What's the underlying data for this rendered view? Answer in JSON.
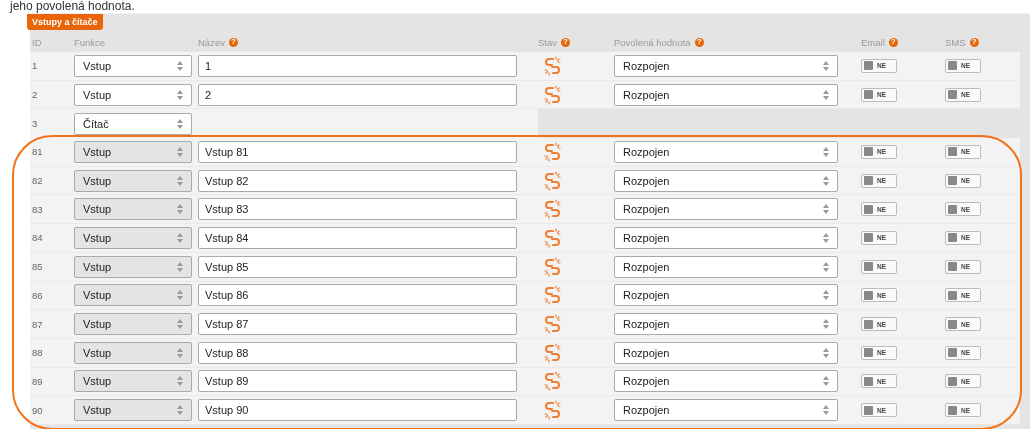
{
  "heading": "jeho povolená hodnota.",
  "section_tab": "Vstupy a čítače",
  "columns": [
    {
      "label": "ID"
    },
    {
      "label": "Funkce"
    },
    {
      "label": "Název",
      "help": "?"
    },
    {
      "label": "Stav",
      "help": "?"
    },
    {
      "label": "Povolená hodnota",
      "help": "?"
    },
    {
      "label": "Email",
      "help": "?"
    },
    {
      "label": "SMS",
      "help": "?"
    }
  ],
  "row_groups": [
    {
      "highlighted": false,
      "rows": [
        {
          "id": "1",
          "kind": "input",
          "function": {
            "value": "Vstup",
            "disabled": false
          },
          "name": "1",
          "allowed": "Rozpojen",
          "email": {
            "label": "NE",
            "on": false
          },
          "sms": {
            "label": "NE",
            "on": false
          }
        },
        {
          "id": "2",
          "kind": "input",
          "function": {
            "value": "Vstup",
            "disabled": false
          },
          "name": "2",
          "allowed": "Rozpojen",
          "email": {
            "label": "NE",
            "on": false
          },
          "sms": {
            "label": "NE",
            "on": false
          }
        },
        {
          "id": "3",
          "kind": "counter",
          "function": {
            "value": "Čítač",
            "disabled": false
          }
        }
      ]
    },
    {
      "highlighted": true,
      "rows": [
        {
          "id": "81",
          "kind": "input",
          "function": {
            "value": "Vstup",
            "disabled": true
          },
          "name": "Vstup 81",
          "allowed": "Rozpojen",
          "email": {
            "label": "NE",
            "on": false
          },
          "sms": {
            "label": "NE",
            "on": false
          }
        },
        {
          "id": "82",
          "kind": "input",
          "function": {
            "value": "Vstup",
            "disabled": true
          },
          "name": "Vstup 82",
          "allowed": "Rozpojen",
          "email": {
            "label": "NE",
            "on": false
          },
          "sms": {
            "label": "NE",
            "on": false
          }
        },
        {
          "id": "83",
          "kind": "input",
          "function": {
            "value": "Vstup",
            "disabled": true
          },
          "name": "Vstup 83",
          "allowed": "Rozpojen",
          "email": {
            "label": "NE",
            "on": false
          },
          "sms": {
            "label": "NE",
            "on": false
          }
        },
        {
          "id": "84",
          "kind": "input",
          "function": {
            "value": "Vstup",
            "disabled": true
          },
          "name": "Vstup 84",
          "allowed": "Rozpojen",
          "email": {
            "label": "NE",
            "on": false
          },
          "sms": {
            "label": "NE",
            "on": false
          }
        },
        {
          "id": "85",
          "kind": "input",
          "function": {
            "value": "Vstup",
            "disabled": true
          },
          "name": "Vstup 85",
          "allowed": "Rozpojen",
          "email": {
            "label": "NE",
            "on": false
          },
          "sms": {
            "label": "NE",
            "on": false
          }
        },
        {
          "id": "86",
          "kind": "input",
          "function": {
            "value": "Vstup",
            "disabled": true
          },
          "name": "Vstup 86",
          "allowed": "Rozpojen",
          "email": {
            "label": "NE",
            "on": false
          },
          "sms": {
            "label": "NE",
            "on": false
          }
        },
        {
          "id": "87",
          "kind": "input",
          "function": {
            "value": "Vstup",
            "disabled": true
          },
          "name": "Vstup 87",
          "allowed": "Rozpojen",
          "email": {
            "label": "NE",
            "on": false
          },
          "sms": {
            "label": "NE",
            "on": false
          }
        },
        {
          "id": "88",
          "kind": "input",
          "function": {
            "value": "Vstup",
            "disabled": true
          },
          "name": "Vstup 88",
          "allowed": "Rozpojen",
          "email": {
            "label": "NE",
            "on": false
          },
          "sms": {
            "label": "NE",
            "on": false
          }
        },
        {
          "id": "89",
          "kind": "input",
          "function": {
            "value": "Vstup",
            "disabled": true
          },
          "name": "Vstup 89",
          "allowed": "Rozpojen",
          "email": {
            "label": "NE",
            "on": false
          },
          "sms": {
            "label": "NE",
            "on": false
          }
        },
        {
          "id": "90",
          "kind": "input",
          "function": {
            "value": "Vstup",
            "disabled": true
          },
          "name": "Vstup 90",
          "allowed": "Rozpojen",
          "email": {
            "label": "NE",
            "on": false
          },
          "sms": {
            "label": "NE",
            "on": false
          }
        }
      ]
    }
  ]
}
